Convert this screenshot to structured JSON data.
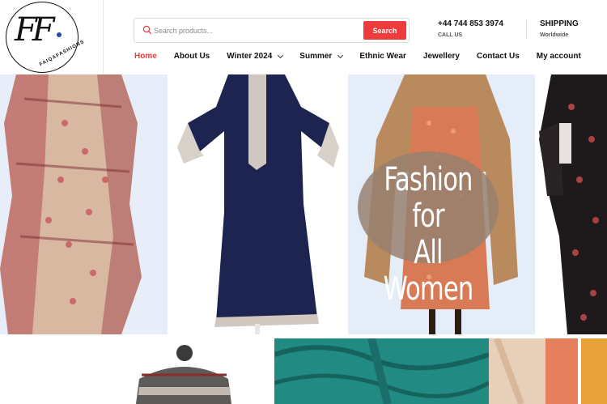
{
  "brand": {
    "logo_letters": "FF",
    "logo_name": "FAIQAFASHIONS"
  },
  "search": {
    "placeholder": "Search products...",
    "button_label": "Search"
  },
  "contact": {
    "phone": "+44 744 853 3974",
    "phone_caption": "CALL US"
  },
  "shipping": {
    "title": "SHIPPING",
    "caption": "Worldwide"
  },
  "nav": {
    "items": [
      {
        "label": "Home",
        "active": true,
        "has_dropdown": false
      },
      {
        "label": "About Us",
        "active": false,
        "has_dropdown": false
      },
      {
        "label": "Winter 2024",
        "active": false,
        "has_dropdown": true
      },
      {
        "label": "Summer",
        "active": false,
        "has_dropdown": true
      },
      {
        "label": "Ethnic Wear",
        "active": false,
        "has_dropdown": false
      },
      {
        "label": "Jewellery",
        "active": false,
        "has_dropdown": false
      },
      {
        "label": "Contact Us",
        "active": false,
        "has_dropdown": false
      },
      {
        "label": "My account",
        "active": false,
        "has_dropdown": false
      }
    ]
  },
  "hero": {
    "tagline_line1": "Fashion for",
    "tagline_line2": "All Women"
  },
  "colors": {
    "accent": "#ee3b3b",
    "hero_panel_bg": "#e7eef9"
  }
}
